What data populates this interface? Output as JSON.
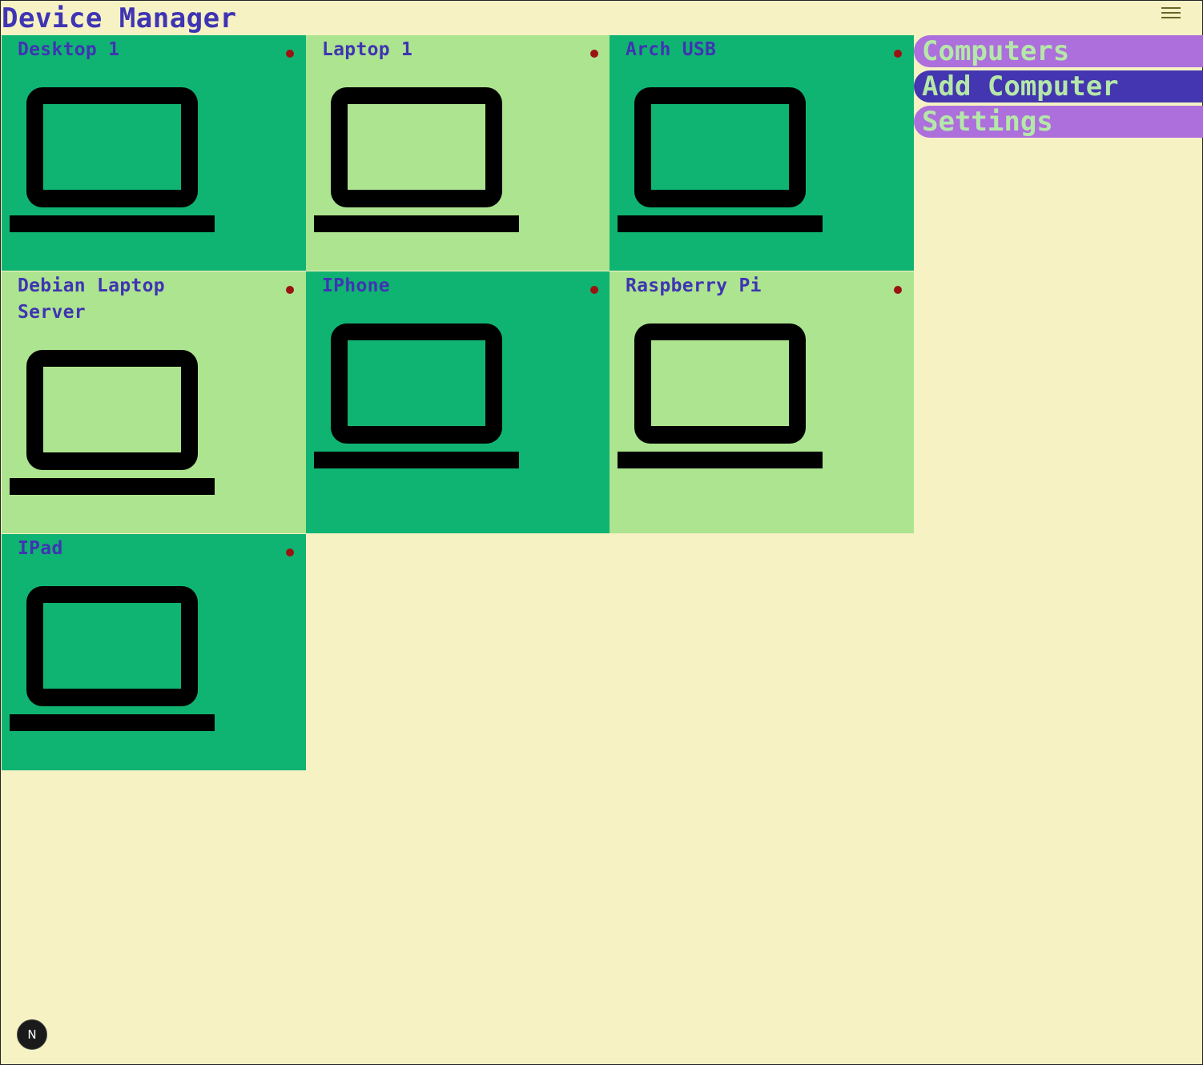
{
  "app": {
    "title": "Device Manager",
    "menu_icon": "hamburger-menu-icon"
  },
  "colors": {
    "background": "#f6f2c4",
    "card_dark": "#10b472",
    "card_light": "#ade48f",
    "title_text": "#3f34b3",
    "status_dot": "#9b1212",
    "nav_inactive_bg": "#ad6fdc",
    "nav_active_bg": "#4436b0",
    "nav_text": "#b5e8a8"
  },
  "computers": [
    {
      "name": "Desktop 1",
      "icon": "laptop-icon",
      "status": "offline"
    },
    {
      "name": "Laptop 1",
      "icon": "laptop-icon",
      "status": "offline"
    },
    {
      "name": "Arch USB",
      "icon": "laptop-icon",
      "status": "offline"
    },
    {
      "name": "Debian Laptop Server",
      "icon": "laptop-icon",
      "status": "offline"
    },
    {
      "name": "IPhone",
      "icon": "laptop-icon",
      "status": "offline"
    },
    {
      "name": "Raspberry Pi",
      "icon": "laptop-icon",
      "status": "offline"
    },
    {
      "name": "IPad",
      "icon": "laptop-icon",
      "status": "offline"
    }
  ],
  "nav": {
    "items": [
      {
        "label": "Computers",
        "active": false
      },
      {
        "label": "Add Computer",
        "active": true
      },
      {
        "label": "Settings",
        "active": false
      }
    ]
  },
  "dev_badge": {
    "label": "N"
  }
}
